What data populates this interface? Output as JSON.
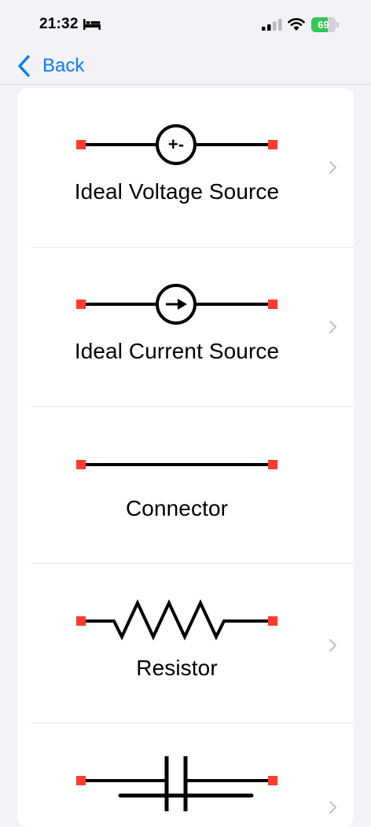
{
  "status_bar": {
    "time": "21:32",
    "battery_level": "69",
    "battery_fraction": 0.69,
    "icons": [
      "bed-icon",
      "cellular-signal-icon",
      "wifi-icon",
      "battery-icon"
    ]
  },
  "nav": {
    "back_label": "Back",
    "back_icon": "chevron-left-icon"
  },
  "colors": {
    "accent": "#0a7aff",
    "terminal": "#ff3b30",
    "battery": "#34c759",
    "background": "#f2f2f7",
    "card": "#ffffff",
    "chevron": "#c4c4c9"
  },
  "components": [
    {
      "label": "Ideal Voltage Source",
      "symbol": "voltage-source-symbol",
      "symbol_text": "+-",
      "has_chevron": true
    },
    {
      "label": "Ideal Current Source",
      "symbol": "current-source-symbol",
      "has_chevron": true
    },
    {
      "label": "Connector",
      "symbol": "connector-symbol",
      "has_chevron": false
    },
    {
      "label": "Resistor",
      "symbol": "resistor-symbol",
      "has_chevron": true
    },
    {
      "label": "",
      "symbol": "capacitor-symbol",
      "has_chevron": true
    }
  ]
}
